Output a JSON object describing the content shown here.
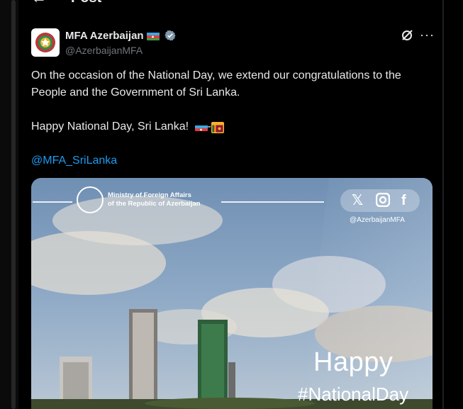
{
  "header": {
    "title": "Post",
    "back_icon": "arrow-left-icon"
  },
  "author": {
    "name": "MFA Azerbaijan",
    "handle": "@AzerbaijanMFA",
    "flag_icon": "azerbaijan-flag-icon",
    "verified_icon": "verified-badge-icon"
  },
  "actions": {
    "grok_icon": "grok-icon",
    "more_icon": "more-horizontal-icon"
  },
  "tweet": {
    "text": "On the occasion of the National Day, we extend our congratulations to the People and the Government of Sri Lanka.",
    "happy_line": "Happy National Day, Sri Lanka!",
    "dash": "-",
    "mention": "@MFA_SriLanka"
  },
  "media": {
    "ministry_line1": "Ministry of Foreign Affairs",
    "ministry_line2": "of the Republic of Azerbaijan",
    "handle": "@AzerbaijanMFA",
    "happy": "Happy",
    "hashtag": "#NationalDay",
    "social_icons": [
      "x-icon",
      "instagram-icon",
      "facebook-icon"
    ]
  },
  "colors": {
    "background": "#000000",
    "link": "#1d9bf0",
    "secondary_text": "#71767b",
    "verified": "#829aab"
  }
}
